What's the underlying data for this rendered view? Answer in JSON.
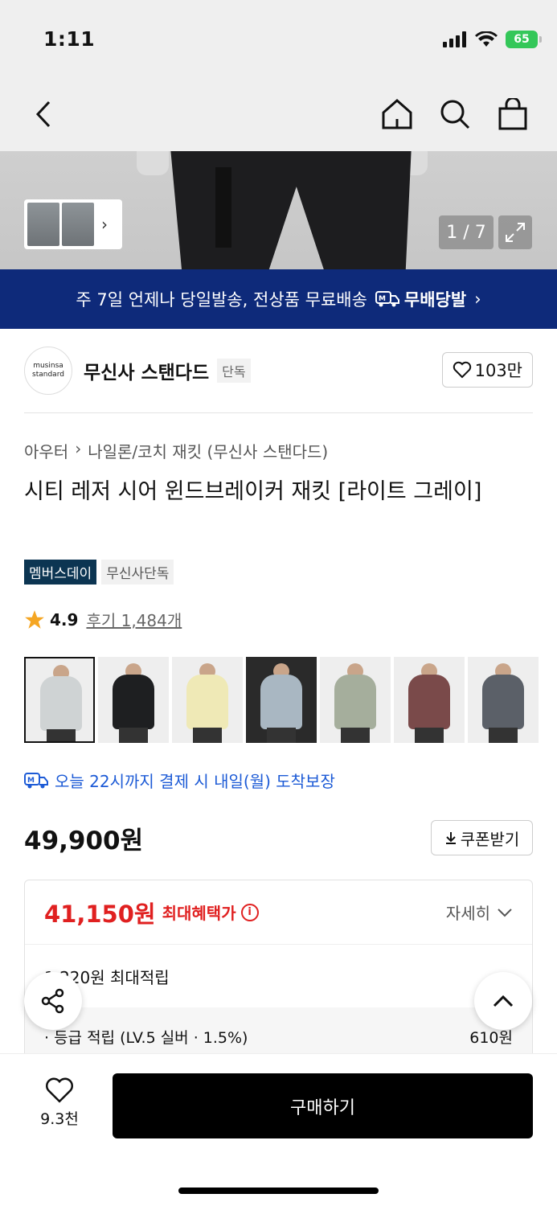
{
  "status_bar": {
    "time": "1:11",
    "battery": "65"
  },
  "nav": {
    "back_icon": "chevron-left-icon",
    "home_icon": "home-icon",
    "search_icon": "search-icon",
    "cart_icon": "shopping-bag-icon"
  },
  "gallery": {
    "counter": "1 / 7"
  },
  "banner": {
    "text": "주 7일 언제나 당일발송, 전상품 무료배송",
    "brand": "무배당발",
    "chevron": "›"
  },
  "brand": {
    "logo_line1": "musinsa",
    "logo_line2": "standard",
    "name": "무신사 스탠다드",
    "tag": "단독",
    "likes": "103만"
  },
  "breadcrumb": {
    "category": "아우터",
    "separator": "›",
    "subcategory": "나일론/코치 재킷 (무신사 스탠다드)"
  },
  "product": {
    "title": "시티 레저 시어 윈드브레이커 재킷 [라이트 그레이]",
    "badge_member": "멤버스데이",
    "badge_exclusive": "무신사단독",
    "rating": "4.9",
    "reviews": "후기 1,484개",
    "colors": [
      "#cfd3d4",
      "#1e1f21",
      "#efe9b6",
      "#a9b7c2",
      "#a5ae9c",
      "#7a4a4a",
      "#5b6068"
    ]
  },
  "delivery": {
    "text": "오늘 22시까지 결제 시 내일(월) 도착보장"
  },
  "pricing": {
    "price": "49,900원",
    "coupon_label": "쿠폰받기",
    "best_price": "41,150원",
    "best_label": "최대혜택가",
    "detail_label": "자세히",
    "points": "1,220원 최대적립",
    "grade_label": "· 등급 적립 (LV.5 실버 · 1.5%)",
    "grade_value": "610원"
  },
  "bottom": {
    "wish_count": "9.3천",
    "buy_label": "구매하기"
  }
}
